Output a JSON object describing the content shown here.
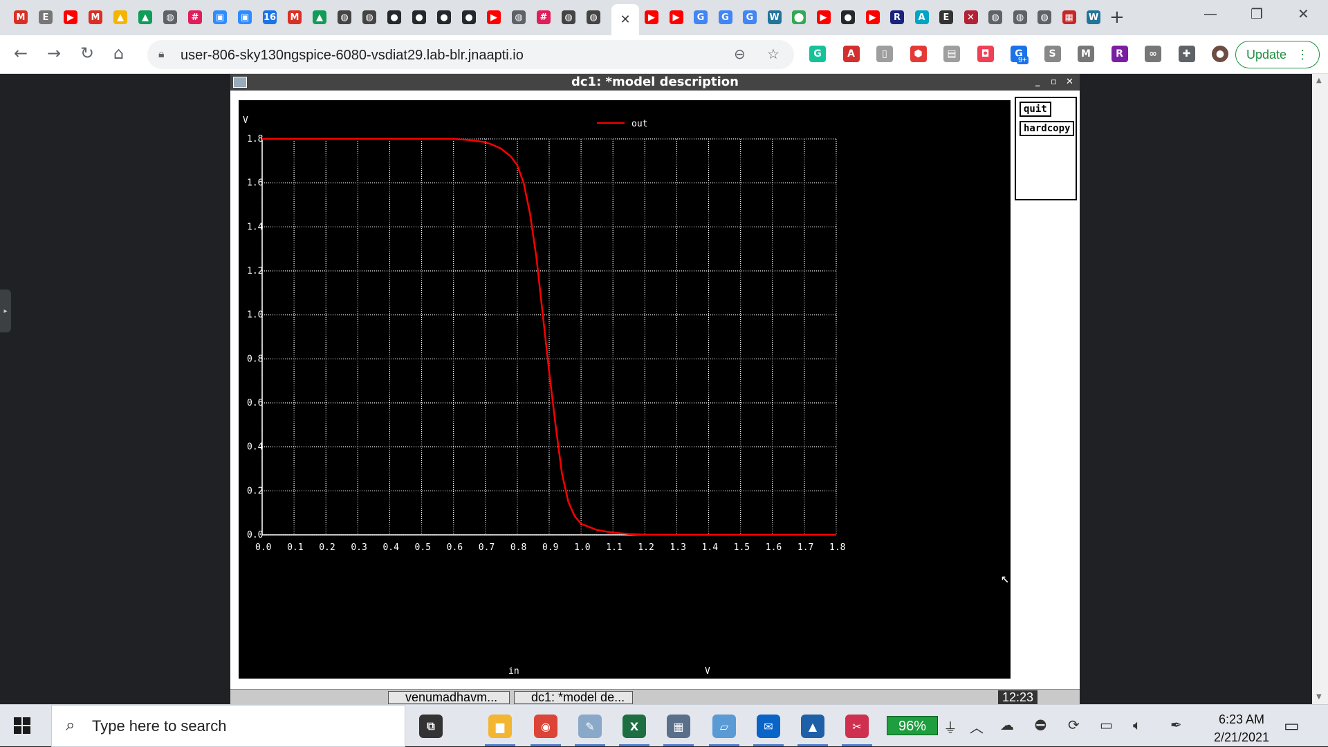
{
  "browser": {
    "tabs": [
      {
        "icon": "gmail-icon",
        "glyph": "M",
        "color": "#d93025"
      },
      {
        "icon": "e-icon",
        "glyph": "E",
        "color": "#777777"
      },
      {
        "icon": "youtube-icon",
        "glyph": "▶",
        "color": "#ff0000"
      },
      {
        "icon": "gmail-icon",
        "glyph": "M",
        "color": "#d93025"
      },
      {
        "icon": "drive-icon",
        "glyph": "▲",
        "color": "#f4b400"
      },
      {
        "icon": "drive-icon",
        "glyph": "▲",
        "color": "#0f9d58"
      },
      {
        "icon": "globe-icon",
        "glyph": "◍",
        "color": "#5f6368"
      },
      {
        "icon": "slack-icon",
        "glyph": "#",
        "color": "#e01e5a"
      },
      {
        "icon": "zoom-icon",
        "glyph": "▣",
        "color": "#2d8cff"
      },
      {
        "icon": "zoom-icon",
        "glyph": "▣",
        "color": "#2d8cff"
      },
      {
        "icon": "calendar-icon",
        "glyph": "16",
        "color": "#1a73e8"
      },
      {
        "icon": "gmail-icon",
        "glyph": "M",
        "color": "#d93025"
      },
      {
        "icon": "drive-icon",
        "glyph": "▲",
        "color": "#0f9d58"
      },
      {
        "icon": "globe-icon",
        "glyph": "◍",
        "color": "#444444"
      },
      {
        "icon": "globe-icon",
        "glyph": "◍",
        "color": "#444444"
      },
      {
        "icon": "github-icon",
        "glyph": "●",
        "color": "#24292e"
      },
      {
        "icon": "github-icon",
        "glyph": "●",
        "color": "#24292e"
      },
      {
        "icon": "github-icon",
        "glyph": "●",
        "color": "#24292e"
      },
      {
        "icon": "github-icon",
        "glyph": "●",
        "color": "#24292e"
      },
      {
        "icon": "youtube-icon",
        "glyph": "▶",
        "color": "#ff0000"
      },
      {
        "icon": "globe-icon",
        "glyph": "◍",
        "color": "#5f6368"
      },
      {
        "icon": "slack-icon",
        "glyph": "#",
        "color": "#e01e5a"
      },
      {
        "icon": "globe-icon",
        "glyph": "◍",
        "color": "#444444"
      },
      {
        "icon": "globe-icon",
        "glyph": "◍",
        "color": "#444444"
      }
    ],
    "tabs_right": [
      {
        "icon": "youtube-icon",
        "glyph": "▶",
        "color": "#ff0000"
      },
      {
        "icon": "youtube-icon",
        "glyph": "▶",
        "color": "#ff0000"
      },
      {
        "icon": "google-icon",
        "glyph": "G",
        "color": "#4285f4"
      },
      {
        "icon": "google-icon",
        "glyph": "G",
        "color": "#4285f4"
      },
      {
        "icon": "google-icon",
        "glyph": "G",
        "color": "#4285f4"
      },
      {
        "icon": "wordpress-icon",
        "glyph": "W",
        "color": "#21759b"
      },
      {
        "icon": "maps-icon",
        "glyph": "⬤",
        "color": "#34a853"
      },
      {
        "icon": "youtube-icon",
        "glyph": "▶",
        "color": "#ff0000"
      },
      {
        "icon": "github-icon",
        "glyph": "●",
        "color": "#24292e"
      },
      {
        "icon": "youtube-icon",
        "glyph": "▶",
        "color": "#ff0000"
      },
      {
        "icon": "r-icon",
        "glyph": "R",
        "color": "#1a237e"
      },
      {
        "icon": "a-icon",
        "glyph": "A",
        "color": "#00a4c4"
      },
      {
        "icon": "misc-icon",
        "glyph": "E",
        "color": "#333333"
      },
      {
        "icon": "flag-icon",
        "glyph": "✕",
        "color": "#b22234"
      },
      {
        "icon": "globe-icon",
        "glyph": "◍",
        "color": "#5f6368"
      },
      {
        "icon": "globe-icon",
        "glyph": "◍",
        "color": "#5f6368"
      },
      {
        "icon": "globe-icon",
        "glyph": "◍",
        "color": "#5f6368"
      },
      {
        "icon": "chart-icon",
        "glyph": "▦",
        "color": "#c62828"
      },
      {
        "icon": "wordpress-icon",
        "glyph": "W",
        "color": "#21759b"
      }
    ],
    "active_tab_close": "✕",
    "new_tab": "+",
    "url": "user-806-sky130ngspice-6080-vsdiat29.lab-blr.jnaapti.io",
    "update_label": "Update",
    "extensions": [
      {
        "icon": "grammarly-icon",
        "glyph": "G",
        "color": "#15c39a"
      },
      {
        "icon": "pdf-icon",
        "glyph": "A",
        "color": "#d32f2f"
      },
      {
        "icon": "doc-icon",
        "glyph": "▯",
        "color": "#9e9e9e"
      },
      {
        "icon": "shield-icon",
        "glyph": "⬢",
        "color": "#e53935"
      },
      {
        "icon": "page-icon",
        "glyph": "▤",
        "color": "#9e9e9e"
      },
      {
        "icon": "pocket-icon",
        "glyph": "◘",
        "color": "#ef4056"
      },
      {
        "icon": "translate-icon",
        "glyph": "G",
        "color": "#1a73e8"
      },
      {
        "icon": "s-icon",
        "glyph": "S",
        "color": "#888888"
      },
      {
        "icon": "mi-icon",
        "glyph": "M",
        "color": "#777777"
      },
      {
        "icon": "r-icon",
        "glyph": "R",
        "color": "#7b1fa2"
      },
      {
        "icon": "link-icon",
        "glyph": "∞",
        "color": "#777777"
      },
      {
        "icon": "puzzle-icon",
        "glyph": "✚",
        "color": "#5f6368"
      },
      {
        "icon": "avatar",
        "glyph": "●",
        "color": "#6d4c41"
      }
    ],
    "badge_9plus": "9+"
  },
  "xwindow": {
    "title": "dc1: *model description",
    "buttons": {
      "quit": "quit",
      "hardcopy": "hardcopy"
    }
  },
  "chart_data": {
    "type": "line",
    "title": "",
    "xlabel": "in",
    "xunit": "V",
    "ylabel": "V",
    "xlim": [
      0.0,
      1.8
    ],
    "ylim": [
      0.0,
      1.8
    ],
    "xticks": [
      "0.0",
      "0.1",
      "0.2",
      "0.3",
      "0.4",
      "0.5",
      "0.6",
      "0.7",
      "0.8",
      "0.9",
      "1.0",
      "1.1",
      "1.2",
      "1.3",
      "1.4",
      "1.5",
      "1.6",
      "1.7",
      "1.8"
    ],
    "yticks": [
      "0.0",
      "0.2",
      "0.4",
      "0.6",
      "0.8",
      "1.0",
      "1.2",
      "1.4",
      "1.6",
      "1.8"
    ],
    "grid": true,
    "legend_position": "top-center",
    "series": [
      {
        "name": "out",
        "color": "#ff0000",
        "x": [
          0.0,
          0.5,
          0.6,
          0.65,
          0.7,
          0.72,
          0.75,
          0.78,
          0.8,
          0.82,
          0.84,
          0.86,
          0.88,
          0.9,
          0.92,
          0.94,
          0.96,
          0.98,
          1.0,
          1.05,
          1.1,
          1.15,
          1.2,
          1.3,
          1.8
        ],
        "y": [
          1.8,
          1.8,
          1.8,
          1.795,
          1.785,
          1.775,
          1.755,
          1.72,
          1.68,
          1.6,
          1.46,
          1.26,
          1.0,
          0.74,
          0.5,
          0.28,
          0.15,
          0.085,
          0.05,
          0.022,
          0.01,
          0.004,
          0.001,
          0.0,
          0.0
        ]
      }
    ]
  },
  "vnc_taskbar": {
    "task1": "venumadhavm...",
    "task2": "dc1: *model de...",
    "clock": "12:23"
  },
  "taskbar": {
    "search_placeholder": "Type here to search",
    "battery": "96%",
    "time": "6:23 AM",
    "date": "2/21/2021",
    "apps": [
      {
        "icon": "task-view-icon",
        "glyph": "⧉",
        "color": "#333333"
      },
      {
        "icon": "file-explorer-icon",
        "glyph": "▆",
        "color": "#f2b632"
      },
      {
        "icon": "chrome-icon",
        "glyph": "◉",
        "color": "#db4437"
      },
      {
        "icon": "paint-icon",
        "glyph": "✎",
        "color": "#8aa8c8"
      },
      {
        "icon": "excel-icon",
        "glyph": "X",
        "color": "#1d6f42"
      },
      {
        "icon": "calculator-icon",
        "glyph": "▦",
        "color": "#5a6f8a"
      },
      {
        "icon": "notes-icon",
        "glyph": "▱",
        "color": "#5a9bd5"
      },
      {
        "icon": "mail-icon",
        "glyph": "✉",
        "color": "#0a64c8"
      },
      {
        "icon": "photos-icon",
        "glyph": "▲",
        "color": "#1e5fa8"
      },
      {
        "icon": "snip-icon",
        "glyph": "✂",
        "color": "#d03050"
      }
    ]
  }
}
